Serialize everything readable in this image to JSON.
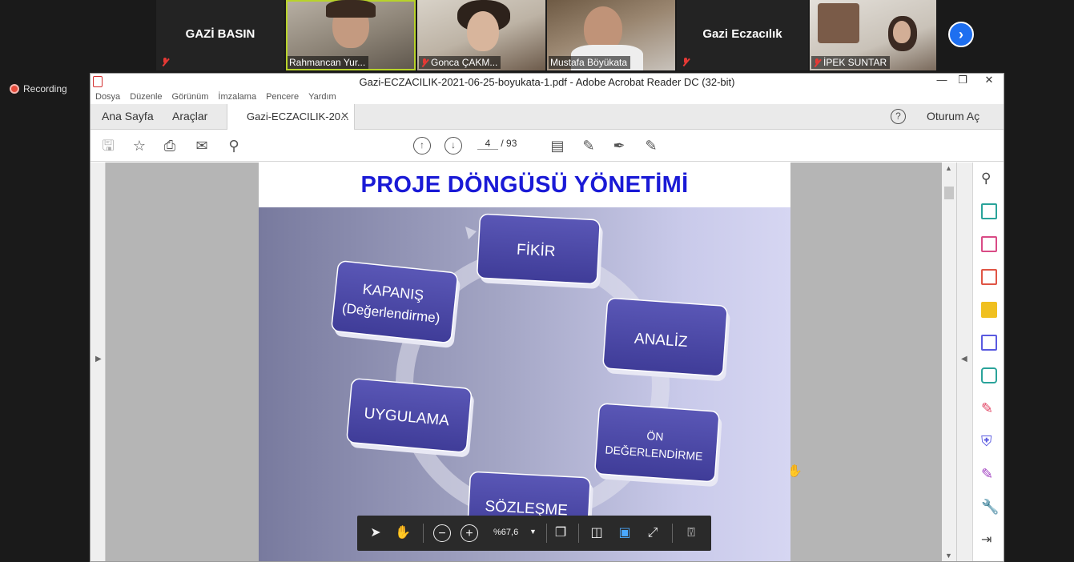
{
  "zoom": {
    "tiles": [
      {
        "name": "GAZİ BASIN",
        "type": "name"
      },
      {
        "name": "Rahmancan Yur...",
        "type": "video"
      },
      {
        "name": "Gonca ÇAKM...",
        "type": "video"
      },
      {
        "name": "Mustafa Böyükata",
        "type": "video"
      },
      {
        "name": "Gazi Eczacılık",
        "type": "name"
      },
      {
        "name": "İPEK SUNTAR",
        "type": "video"
      }
    ],
    "next_icon": "chevron-right-icon",
    "recording_label": "Recording",
    "recording_color": "#e74c3c"
  },
  "acrobat": {
    "window_title": "Gazi-ECZACILIK-2021-06-25-boyukata-1.pdf - Adobe Acrobat Reader DC (32-bit)",
    "menu": [
      "Dosya",
      "Düzenle",
      "Görünüm",
      "İmzalama",
      "Pencere",
      "Yardım"
    ],
    "tabs": {
      "home": "Ana Sayfa",
      "tools": "Araçlar",
      "document": "Gazi-ECZACILIK-20...",
      "signin": "Oturum Aç"
    },
    "page": {
      "current": "4",
      "separator": "/",
      "total": "93"
    },
    "zoom_level": "%67,6",
    "accent": "#1a1ad6"
  },
  "slide": {
    "title": "PROJE DÖNGÜSÜ YÖNETİMİ",
    "boxes": {
      "fikir": "FİKİR",
      "analiz": "ANALİZ",
      "on1": "ÖN",
      "on2": "DEĞERLENDİRME",
      "sozlesme": "SÖZLEŞME",
      "uygulama": "UYGULAMA",
      "kapanis1": "KAPANIŞ",
      "kapanis2": "(Değerlendirme)"
    },
    "box_color": "#4d4aa8"
  }
}
